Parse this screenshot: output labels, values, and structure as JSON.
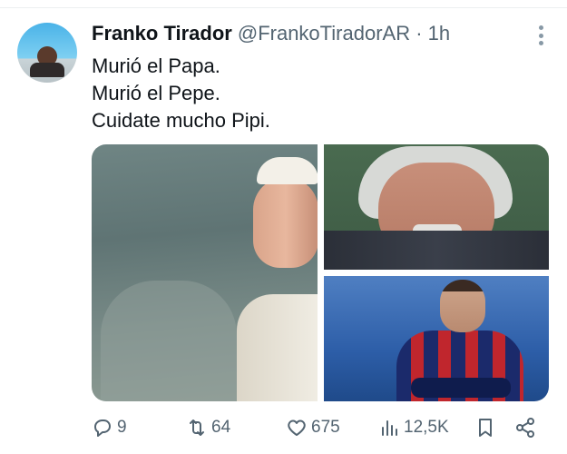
{
  "tweet": {
    "author_name": "Franko Tirador",
    "handle": "@FrankoTiradorAR",
    "separator": "·",
    "time": "1h",
    "lines": [
      "Murió el Papa.",
      "Murió el Pepe.",
      "Cuidate mucho Pipi."
    ]
  },
  "media": {
    "images": [
      "pope-photo",
      "pepe-photo",
      "pipi-photo"
    ]
  },
  "actions": {
    "replies": "9",
    "reposts": "64",
    "likes": "675",
    "views": "12,5K"
  },
  "icons": {
    "reply": "reply-icon",
    "repost": "repost-icon",
    "like": "heart-icon",
    "views": "views-icon",
    "bookmark": "bookmark-icon",
    "share": "share-icon",
    "more": "more-icon"
  },
  "colors": {
    "text": "#0f1419",
    "muted": "#536471"
  }
}
